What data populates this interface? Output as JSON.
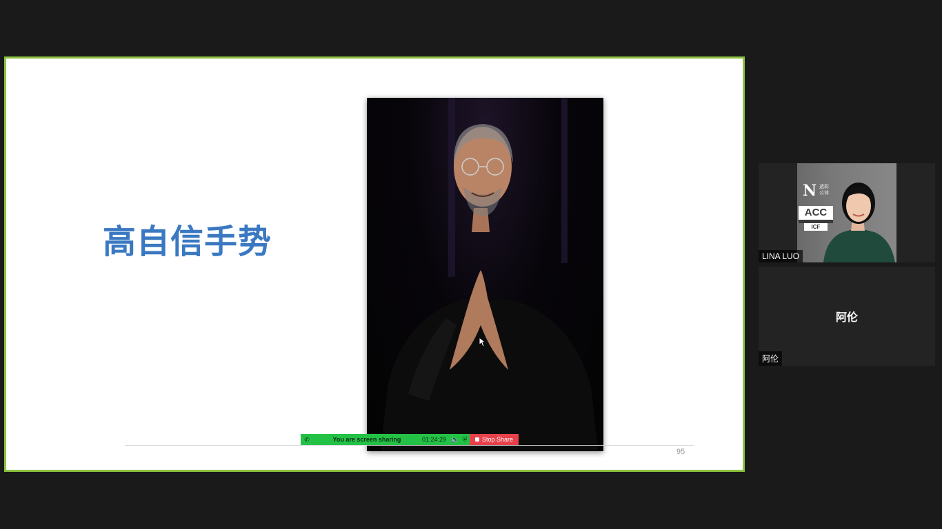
{
  "slide": {
    "title": "高自信手势",
    "page_number": "95"
  },
  "share_bar": {
    "status_text": "You are screen sharing",
    "timer": "01:24:29",
    "stop_label": "Stop Share"
  },
  "participants": [
    {
      "name": "LINA LUO",
      "video_on": true,
      "background_logo_text": [
        "透彩",
        "公体"
      ],
      "badge_top": "ACC",
      "badge_bottom": "ICF"
    },
    {
      "name": "阿伦",
      "display_name_center": "阿伦",
      "video_on": false
    }
  ],
  "colors": {
    "share_border": "#8dc33f",
    "title_color": "#3a78c2",
    "share_bar_green": "#23c247",
    "stop_red": "#e8414b"
  }
}
